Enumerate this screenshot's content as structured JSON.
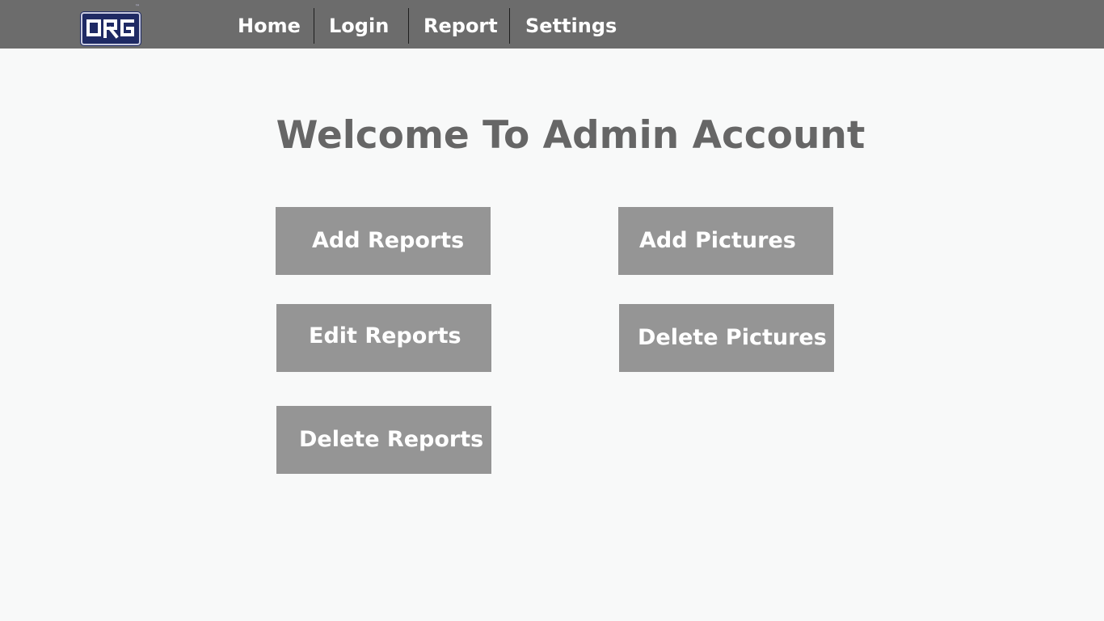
{
  "nav": {
    "logo_text": "ORG",
    "logo_tm": "™",
    "items": [
      {
        "label": "Home"
      },
      {
        "label": "Login"
      },
      {
        "label": "Report"
      },
      {
        "label": "Settings"
      }
    ]
  },
  "main": {
    "title": "Welcome To Admin Account",
    "buttons": {
      "add_reports": "Add Reports",
      "add_pictures": "Add Pictures",
      "edit_reports": "Edit Reports",
      "delete_pictures": "Delete Pictures",
      "delete_reports": "Delete Reports"
    }
  },
  "colors": {
    "nav_bg": "#6c6c6c",
    "page_bg": "#f8f9f9",
    "button_bg": "#959595",
    "title_color": "#666666",
    "logo_bg": "#1f2a64"
  }
}
